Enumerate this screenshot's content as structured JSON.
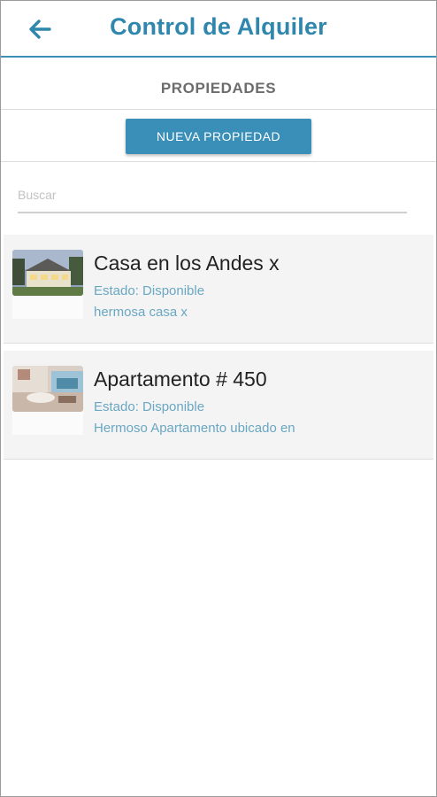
{
  "appbar": {
    "title": "Control de Alquiler",
    "back_icon": "arrow-left-icon"
  },
  "section": {
    "title": "PROPIEDADES"
  },
  "actions": {
    "new_property_label": "NUEVA PROPIEDAD"
  },
  "search": {
    "placeholder": "Buscar",
    "value": ""
  },
  "properties": [
    {
      "name": "Casa en los Andes x",
      "status": "Estado: Disponible",
      "description": "hermosa casa x",
      "image": "house-photo"
    },
    {
      "name": "Apartamento # 450",
      "status": "Estado: Disponible",
      "description": "Hermoso Apartamento ubicado en",
      "image": "apartment-photo"
    }
  ],
  "colors": {
    "accent": "#2f87ad",
    "button": "#3a8fb8",
    "subtext": "#6aa7c2"
  }
}
